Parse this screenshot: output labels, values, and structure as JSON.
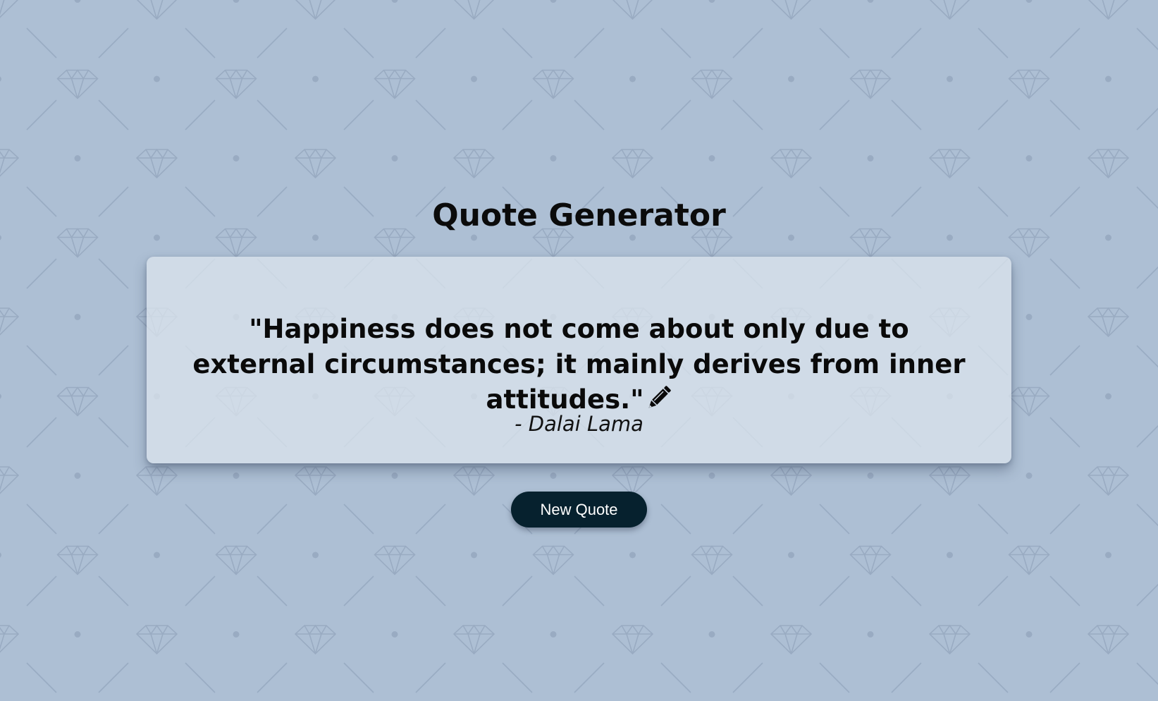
{
  "title": "Quote Generator",
  "quote": {
    "text": "\"Happiness does not come about only due to external circumstances; it mainly derives from inner attitudes.\"",
    "author": "- Dalai Lama",
    "icon": "pencil-icon"
  },
  "new_quote_button": {
    "label": "New Quote"
  },
  "colors": {
    "background": "#adbfd4",
    "card": "#d3dde8",
    "button": "#06212e",
    "button_text": "#ffffff",
    "pattern": "#97a9c0"
  },
  "background_pattern": "diamond-pattern"
}
